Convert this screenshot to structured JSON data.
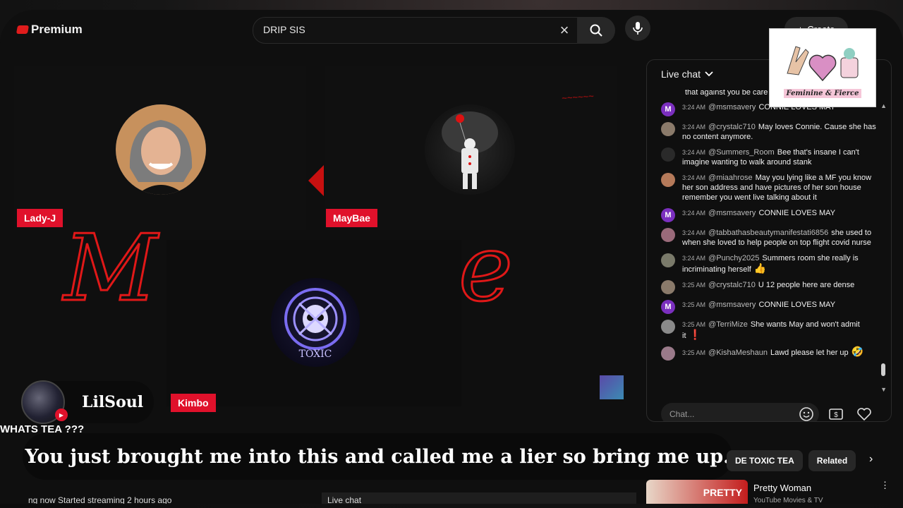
{
  "header": {
    "brand": "Premium",
    "search_query": "DRIP SIS",
    "create_label": "Create"
  },
  "panels": [
    {
      "name": "Lady-J"
    },
    {
      "name": "MayBae"
    },
    {
      "name": "Kimbo",
      "avatar_text": "TOXIC"
    }
  ],
  "chat": {
    "title": "Live chat",
    "placeholder": "Chat...",
    "partial_top": "that against you be care",
    "messages": [
      {
        "time": "3:24 AM",
        "author": "@msmsavery",
        "text": "CONNIE LOVES MAY",
        "avatar_letter": "M",
        "avatar_color": "#7b2fbf"
      },
      {
        "time": "3:24 AM",
        "author": "@crystalc710",
        "text": "May loves Connie. Cause she has no content anymore.",
        "avatar_letter": "",
        "avatar_color": "#8a7a6a"
      },
      {
        "time": "3:24 AM",
        "author": "@Summers_Room",
        "text": "Bee that's insane I can't imagine wanting to walk around stank",
        "avatar_letter": "",
        "avatar_color": "#2a2a2a"
      },
      {
        "time": "3:24 AM",
        "author": "@miaahrose",
        "text": "May you lying like a MF you know her son address and have pictures of her son house remember you went live talking about it",
        "avatar_letter": "",
        "avatar_color": "#b57a5a"
      },
      {
        "time": "3:24 AM",
        "author": "@msmsavery",
        "text": "CONNIE LOVES MAY",
        "avatar_letter": "M",
        "avatar_color": "#7b2fbf"
      },
      {
        "time": "3:24 AM",
        "author": "@tabbathasbeautymanifestati6856",
        "text": "she used to when she loved to help people on top flight covid nurse",
        "avatar_letter": "",
        "avatar_color": "#9a6a7a"
      },
      {
        "time": "3:24 AM",
        "author": "@Punchy2025",
        "text": "Summers room she really is incriminating herself",
        "emoji": "👍",
        "avatar_letter": "",
        "avatar_color": "#7a7a6a"
      },
      {
        "time": "3:25 AM",
        "author": "@crystalc710",
        "text": "U 12 people here are dense",
        "avatar_letter": "",
        "avatar_color": "#8a7a6a"
      },
      {
        "time": "3:25 AM",
        "author": "@msmsavery",
        "text": "CONNIE LOVES MAY",
        "avatar_letter": "M",
        "avatar_color": "#7b2fbf"
      },
      {
        "time": "3:25 AM",
        "author": "@TerriMize",
        "text": "She wants May and won't admit it",
        "emoji": "❗",
        "avatar_letter": "",
        "avatar_color": "#8a8a8a"
      },
      {
        "time": "3:25 AM",
        "author": "@KishaMeshaun",
        "text": "Lawd please let her up",
        "emoji": "🤣",
        "avatar_letter": "",
        "avatar_color": "#9a7a8a"
      }
    ]
  },
  "overlay_logo": {
    "text": "Feminine & Fierce"
  },
  "host": {
    "name": "LilSoul"
  },
  "whats_tea": "WHATS TEA ???",
  "caption": "You just brought me into this and called me a lier so bring me up.",
  "info_bar": "ng now  Started streaming 2 hours ago",
  "live_chat_tab": "Live chat",
  "chips": [
    "DE TOXIC TEA",
    "Related"
  ],
  "recommendation": {
    "title": "Pretty Woman",
    "channel": "YouTube Movies & TV",
    "thumb_text": "PRETTY"
  },
  "neon_text": [
    "M",
    "e"
  ],
  "colors": {
    "accent_red": "#e0112b",
    "neon_red": "#e01818",
    "panel_bg": "#101010"
  }
}
